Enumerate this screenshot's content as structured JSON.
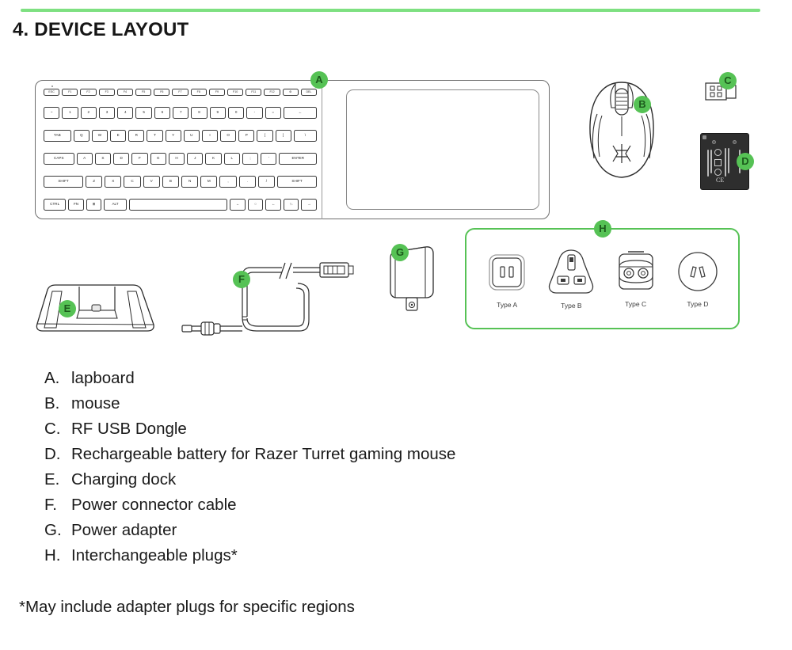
{
  "page": {
    "title": "4. DEVICE LAYOUT",
    "accent_color": "#7ee081",
    "badge_color": "#56c255",
    "background": "#ffffff"
  },
  "diagram": {
    "callouts": [
      {
        "id": "A",
        "label": "A",
        "target": "lapboard"
      },
      {
        "id": "B",
        "label": "B",
        "target": "mouse"
      },
      {
        "id": "C",
        "label": "C",
        "target": "rf-usb-dongle"
      },
      {
        "id": "D",
        "label": "D",
        "target": "rechargeable-battery"
      },
      {
        "id": "E",
        "label": "E",
        "target": "charging-dock"
      },
      {
        "id": "F",
        "label": "F",
        "target": "power-connector-cable"
      },
      {
        "id": "G",
        "label": "G",
        "target": "power-adapter"
      },
      {
        "id": "H",
        "label": "H",
        "target": "interchangeable-plugs"
      }
    ],
    "plugs": [
      {
        "caption": "Type A"
      },
      {
        "caption": "Type B"
      },
      {
        "caption": "Type C"
      },
      {
        "caption": "Type D"
      }
    ],
    "keyboard": {
      "rows": [
        [
          "ESC",
          "F1",
          "F2",
          "F3",
          "F4",
          "F5",
          "F6",
          "F7",
          "F8",
          "F9",
          "F10",
          "F11",
          "F12",
          "⚙",
          "DEL"
        ],
        [
          "~",
          "1",
          "2",
          "3",
          "4",
          "5",
          "6",
          "7",
          "8",
          "9",
          "0",
          "-",
          "=",
          "←"
        ],
        [
          "TAB",
          "Q",
          "W",
          "E",
          "R",
          "T",
          "Y",
          "U",
          "I",
          "O",
          "P",
          "[",
          "]",
          "\\"
        ],
        [
          "CAPS",
          "A",
          "S",
          "D",
          "F",
          "G",
          "H",
          "J",
          "K",
          "L",
          ";",
          "'",
          "ENTER"
        ],
        [
          "SHIFT",
          "Z",
          "X",
          "C",
          "V",
          "B",
          "N",
          "M",
          ",",
          ".",
          "/",
          "SHIFT"
        ],
        [
          "CTRL",
          "FN",
          "⊞",
          "ALT",
          "",
          "←",
          "○",
          "←",
          "↑↓",
          "→"
        ]
      ]
    }
  },
  "legend": {
    "items": [
      {
        "key": "A.",
        "label": "lapboard"
      },
      {
        "key": "B.",
        "label": "mouse"
      },
      {
        "key": "C.",
        "label": "RF USB Dongle"
      },
      {
        "key": "D.",
        "label": "Rechargeable battery for Razer Turret gaming mouse"
      },
      {
        "key": "E.",
        "label": "Charging dock"
      },
      {
        "key": "F.",
        "label": "Power connector cable"
      },
      {
        "key": "G.",
        "label": "Power adapter"
      },
      {
        "key": "H.",
        "label": "Interchangeable plugs*"
      }
    ]
  },
  "footnote": "*May include adapter plugs for specific regions"
}
